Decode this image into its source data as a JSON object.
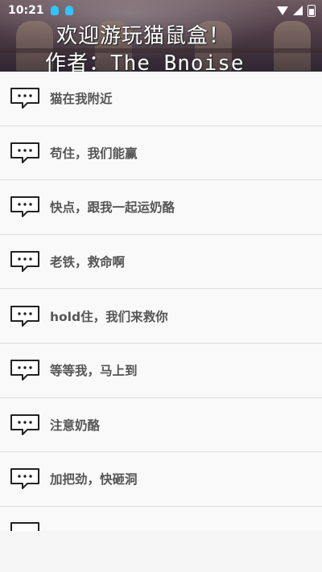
{
  "status_bar": {
    "time": "10:21",
    "notification_icons": [
      "qq-icon",
      "qq-icon"
    ],
    "right_icons": [
      "wifi-icon",
      "signal-icon",
      "battery-icon"
    ]
  },
  "banner": {
    "title": "欢迎游玩猫鼠盒！",
    "author": "作者：The_Bnoise"
  },
  "messages": [
    {
      "label": "猫在我附近"
    },
    {
      "label": "苟住，我们能赢"
    },
    {
      "label": "快点，跟我一起运奶酪"
    },
    {
      "label": "老铁，救命啊"
    },
    {
      "label": "hold住，我们来救你"
    },
    {
      "label": "等等我，马上到"
    },
    {
      "label": "注意奶酪"
    },
    {
      "label": "加把劲，快砸洞"
    }
  ],
  "colors": {
    "list_bg": "#f9f9f9",
    "divider": "#dcdcdc",
    "text": "#555555"
  }
}
